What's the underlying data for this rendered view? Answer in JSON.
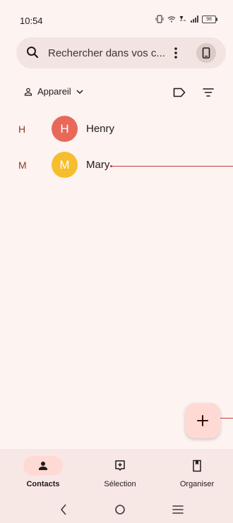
{
  "status_bar": {
    "time": "10:54",
    "battery": "98"
  },
  "search": {
    "placeholder": "Rechercher dans vos c..."
  },
  "filter": {
    "account_label": "Appareil"
  },
  "contacts": [
    {
      "letter": "H",
      "initial": "H",
      "name": "Henry",
      "color": "#e8695a"
    },
    {
      "letter": "M",
      "initial": "M",
      "name": "Mary",
      "color": "#f6be2c"
    }
  ],
  "fab": {
    "icon": "plus-icon"
  },
  "bottom_nav": {
    "items": [
      {
        "label": "Contacts",
        "icon": "person-icon",
        "active": true
      },
      {
        "label": "Sélection",
        "icon": "highlight-add-icon",
        "active": false
      },
      {
        "label": "Organiser",
        "icon": "bookmark-icon",
        "active": false
      }
    ]
  },
  "colors": {
    "background": "#fdf3f1",
    "accent": "#ffdad4",
    "annotation_line": "#c23b35"
  }
}
